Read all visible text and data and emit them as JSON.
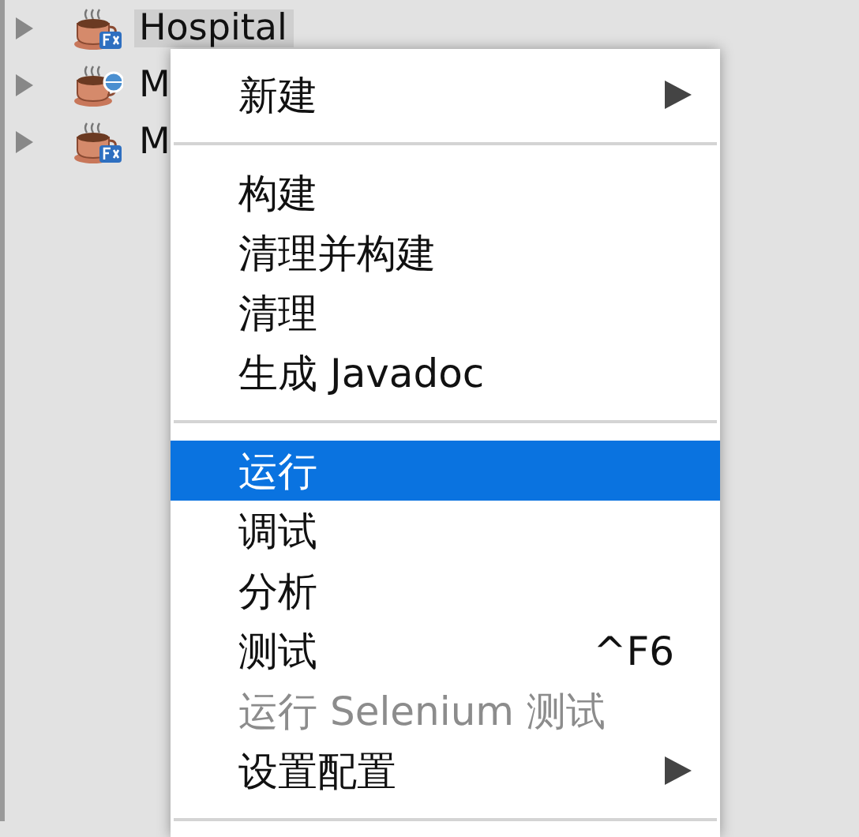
{
  "tree": {
    "items": [
      {
        "label": "Hospital",
        "selected": true,
        "expanded": false,
        "kind": "fx"
      },
      {
        "label": "M",
        "selected": false,
        "expanded": false,
        "kind": "web"
      },
      {
        "label": "M",
        "selected": false,
        "expanded": false,
        "kind": "fx"
      }
    ]
  },
  "context_menu": {
    "items": [
      {
        "kind": "item",
        "label": "新建",
        "submenu": true,
        "selected": false,
        "disabled": false
      },
      {
        "kind": "separator"
      },
      {
        "kind": "item",
        "label": "构建",
        "selected": false,
        "disabled": false
      },
      {
        "kind": "item",
        "label": "清理并构建",
        "selected": false,
        "disabled": false
      },
      {
        "kind": "item",
        "label": "清理",
        "selected": false,
        "disabled": false
      },
      {
        "kind": "item",
        "label": "生成 Javadoc",
        "selected": false,
        "disabled": false
      },
      {
        "kind": "separator"
      },
      {
        "kind": "item",
        "label": "运行",
        "selected": true,
        "disabled": false
      },
      {
        "kind": "item",
        "label": "调试",
        "selected": false,
        "disabled": false
      },
      {
        "kind": "item",
        "label": "分析",
        "selected": false,
        "disabled": false
      },
      {
        "kind": "item",
        "label": "测试",
        "shortcut": "^F6",
        "selected": false,
        "disabled": false
      },
      {
        "kind": "item",
        "label": "运行 Selenium 测试",
        "selected": false,
        "disabled": true
      },
      {
        "kind": "item",
        "label": "设置配置",
        "submenu": true,
        "selected": false,
        "disabled": false
      },
      {
        "kind": "separator"
      }
    ]
  }
}
